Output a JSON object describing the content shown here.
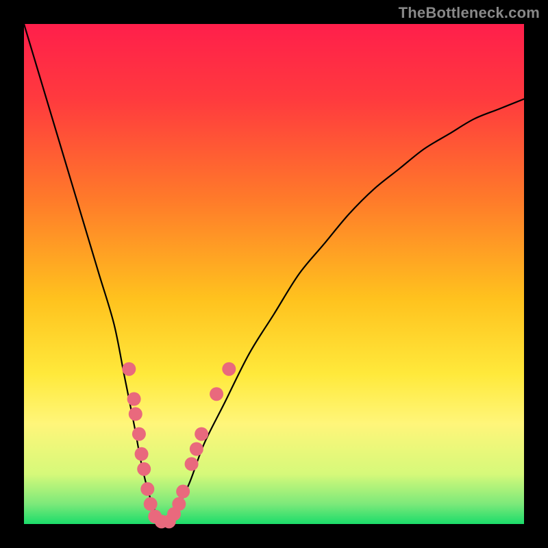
{
  "watermark": "TheBottleneck.com",
  "chart_data": {
    "type": "line",
    "title": "",
    "xlabel": "",
    "ylabel": "",
    "xlim": [
      0,
      100
    ],
    "ylim": [
      0,
      100
    ],
    "background_gradient": {
      "stops": [
        {
          "offset": 0.0,
          "color": "#ff1f4b"
        },
        {
          "offset": 0.15,
          "color": "#ff3a3e"
        },
        {
          "offset": 0.35,
          "color": "#ff7a2a"
        },
        {
          "offset": 0.55,
          "color": "#ffc21e"
        },
        {
          "offset": 0.7,
          "color": "#ffe93b"
        },
        {
          "offset": 0.8,
          "color": "#fff67a"
        },
        {
          "offset": 0.9,
          "color": "#d6f97a"
        },
        {
          "offset": 0.96,
          "color": "#7ce97a"
        },
        {
          "offset": 1.0,
          "color": "#1bdc6a"
        }
      ]
    },
    "series": [
      {
        "name": "bottleneck-curve",
        "x": [
          0,
          3,
          6,
          9,
          12,
          15,
          18,
          20,
          22,
          23.5,
          25,
          26.5,
          28,
          30,
          33,
          36,
          40,
          45,
          50,
          55,
          60,
          65,
          70,
          75,
          80,
          85,
          90,
          95,
          100
        ],
        "y": [
          100,
          90,
          80,
          70,
          60,
          50,
          40,
          30,
          20,
          12,
          6,
          2,
          0,
          2,
          8,
          16,
          24,
          34,
          42,
          50,
          56,
          62,
          67,
          71,
          75,
          78,
          81,
          83,
          85
        ],
        "stroke": "#000000",
        "stroke_width": 2.2
      }
    ],
    "scatter_overlay": {
      "name": "sample-points",
      "color": "#e9697d",
      "radius": 10,
      "points": [
        {
          "x": 21.0,
          "y": 31
        },
        {
          "x": 22.0,
          "y": 25
        },
        {
          "x": 22.3,
          "y": 22
        },
        {
          "x": 23.0,
          "y": 18
        },
        {
          "x": 23.5,
          "y": 14
        },
        {
          "x": 24.0,
          "y": 11
        },
        {
          "x": 24.7,
          "y": 7
        },
        {
          "x": 25.3,
          "y": 4
        },
        {
          "x": 26.2,
          "y": 1.5
        },
        {
          "x": 27.5,
          "y": 0.5
        },
        {
          "x": 29.0,
          "y": 0.5
        },
        {
          "x": 30.0,
          "y": 2
        },
        {
          "x": 31.0,
          "y": 4
        },
        {
          "x": 31.8,
          "y": 6.5
        },
        {
          "x": 33.5,
          "y": 12
        },
        {
          "x": 34.5,
          "y": 15
        },
        {
          "x": 35.5,
          "y": 18
        },
        {
          "x": 38.5,
          "y": 26
        },
        {
          "x": 41.0,
          "y": 31
        }
      ]
    }
  }
}
